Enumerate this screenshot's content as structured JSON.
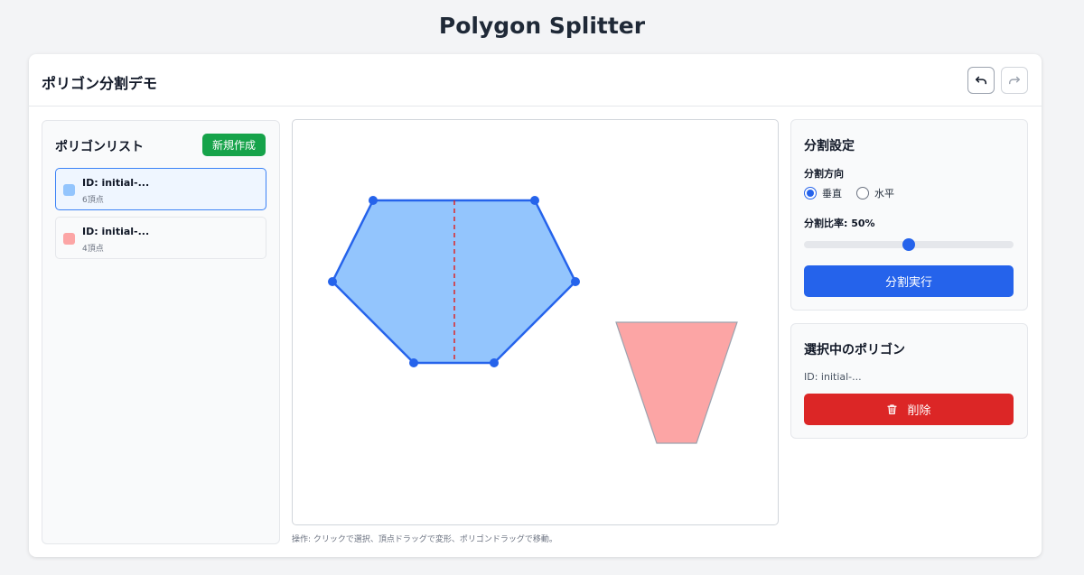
{
  "page_title": "Polygon Splitter",
  "header": {
    "title": "ポリゴン分割デモ",
    "undo_icon": "undo-icon",
    "redo_icon": "redo-icon"
  },
  "polygon_list": {
    "heading": "ポリゴンリスト",
    "new_button": "新規作成",
    "items": [
      {
        "id_label": "ID: initial-...",
        "vertices_label": "6頂点",
        "color": "#93c5fd",
        "selected": true
      },
      {
        "id_label": "ID: initial-...",
        "vertices_label": "4頂点",
        "color": "#fca5a5",
        "selected": false
      }
    ]
  },
  "canvas": {
    "hint": "操作: クリックで選択、頂点ドラッグで変形、ポリゴンドラッグで移動。",
    "selected_fill": "#93c5fd",
    "selected_stroke": "#2563eb",
    "other_fill": "#fca5a5",
    "other_stroke": "#9ca3af",
    "split_line_color": "#dc2626"
  },
  "settings": {
    "title": "分割設定",
    "direction_label": "分割方向",
    "options": [
      "垂直",
      "水平"
    ],
    "selected_option": "垂直",
    "ratio_label": "分割比率: 50%",
    "ratio_value": 0.5,
    "split_button": "分割実行"
  },
  "selected_panel": {
    "title": "選択中のポリゴン",
    "id_text": "ID: initial-...",
    "delete_button": "削除",
    "delete_icon": "trash-icon"
  },
  "colors": {
    "accent": "#2563eb",
    "success": "#16a34a",
    "danger": "#dc2626"
  }
}
